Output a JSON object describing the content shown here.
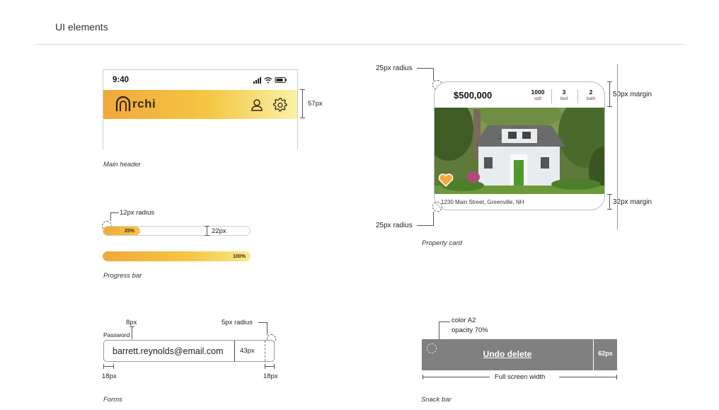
{
  "page": {
    "title": "UI elements"
  },
  "sections": {
    "header": {
      "caption": "Main header",
      "time": "9:40",
      "logo_text": "rchi",
      "height_annotation": "57px"
    },
    "progress": {
      "caption": "Progress bar",
      "radius_annotation": "12px radius",
      "height_annotation": "22px",
      "bars": [
        {
          "label": "25%",
          "value": 0.25
        },
        {
          "label": "100%",
          "value": 1.0
        }
      ]
    },
    "forms": {
      "caption": "Forms",
      "label": "Password",
      "value": "barrett.reynolds@email.com",
      "height_annotation": "43px",
      "spacing_annotation": "8px",
      "radius_annotation": "5px radius",
      "left_padding": "18px",
      "right_padding": "18px"
    },
    "card": {
      "caption": "Property card",
      "price": "$500,000",
      "stats": [
        {
          "value": "1000",
          "label": "sqft"
        },
        {
          "value": "3",
          "label": "bed"
        },
        {
          "value": "2",
          "label": "bath"
        }
      ],
      "address": "1230 Main Street, Greenville, NH",
      "top_radius": "25px radius",
      "bottom_radius": "25px radius",
      "top_margin": "50px margin",
      "bottom_margin": "32px margin"
    },
    "snackbar": {
      "caption": "Snack bar",
      "text": "Undo delete",
      "side_label": "62px",
      "color_note": "color A2",
      "opacity_note": "opacity 70%",
      "width_note": "Full screen width"
    }
  },
  "colors": {
    "accent_start": "#f0a93a",
    "accent_end": "#f5c744",
    "snackbar": "#808080",
    "favorite": "#f2a93b"
  },
  "icons": [
    "signal-icon",
    "wifi-icon",
    "battery-icon",
    "logo-arch-icon",
    "user-icon",
    "gear-icon",
    "heart-icon"
  ]
}
